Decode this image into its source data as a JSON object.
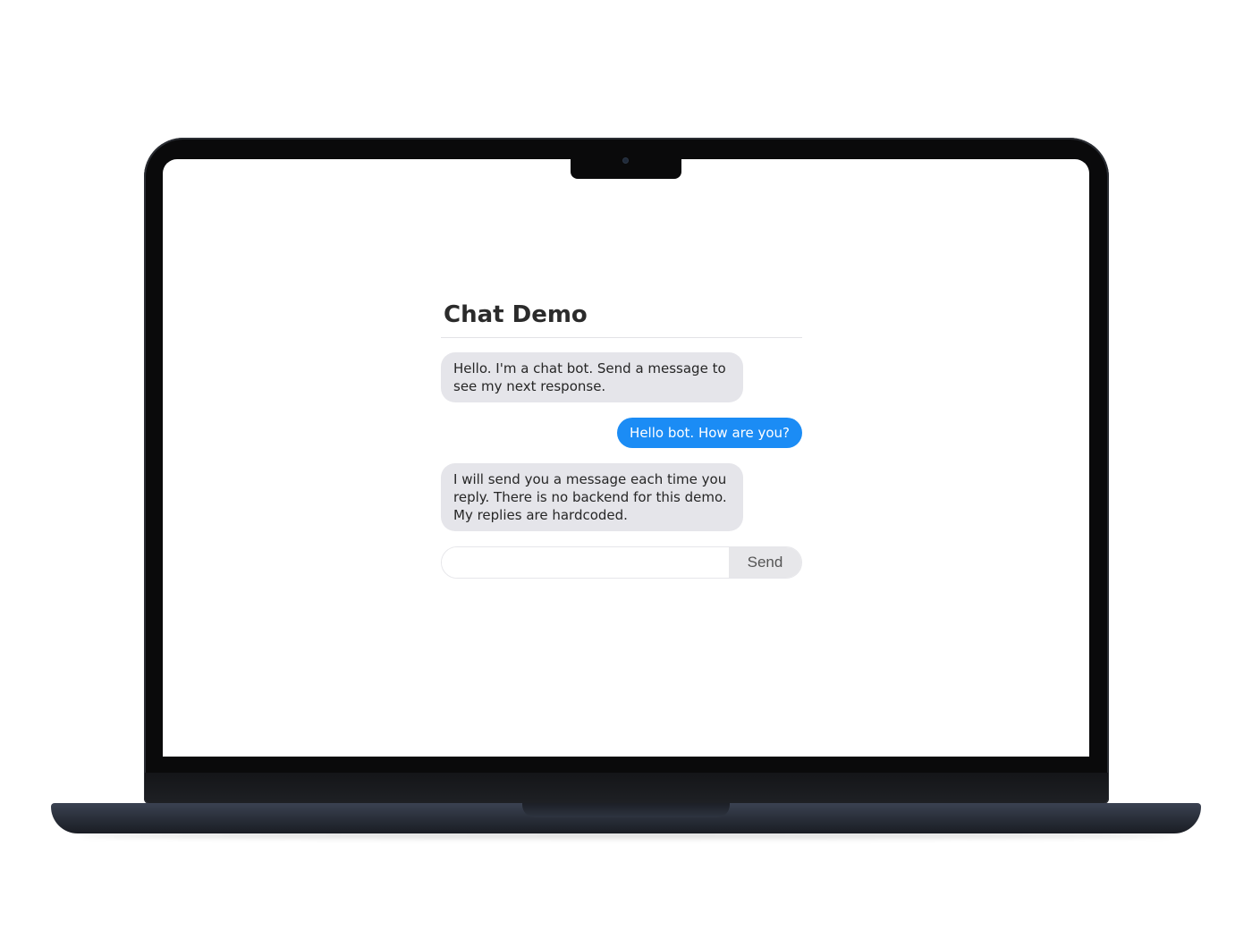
{
  "chat": {
    "title": "Chat Demo",
    "messages": [
      {
        "sender": "bot",
        "text": "Hello. I'm a chat bot. Send a message to see my next response."
      },
      {
        "sender": "user",
        "text": "Hello bot. How are you?"
      },
      {
        "sender": "bot",
        "text": "I will send you a message each time you reply. There is no backend for this demo. My replies are hardcoded."
      }
    ],
    "input": {
      "value": "",
      "placeholder": ""
    },
    "send_label": "Send"
  },
  "colors": {
    "user_bubble": "#1b8cf5",
    "bot_bubble": "#e5e5ea",
    "send_button": "#e7e7ea"
  }
}
